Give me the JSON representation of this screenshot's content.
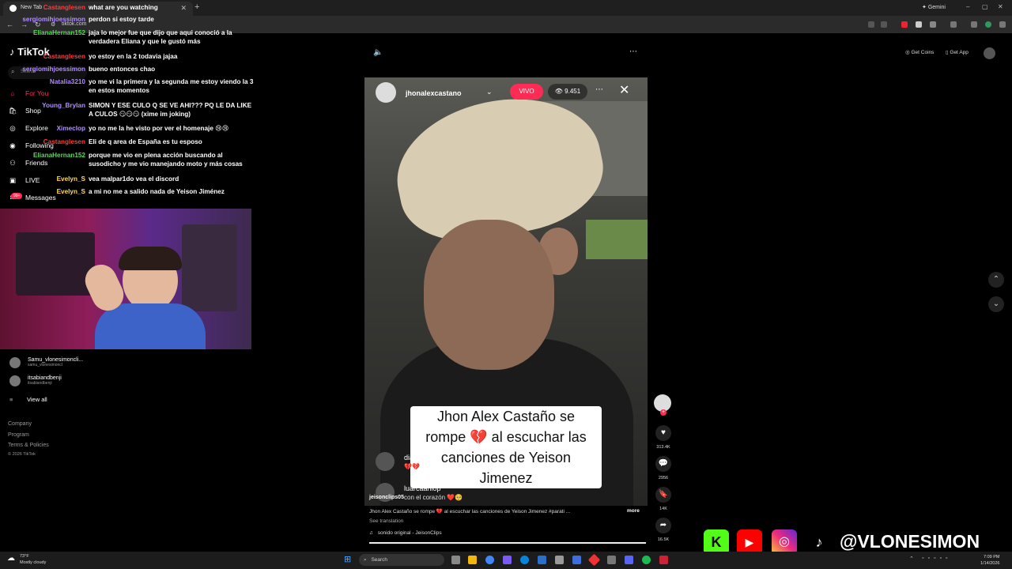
{
  "browser": {
    "tab_title": "New Tab",
    "url": "tiktok.com",
    "gemini_label": "Gemini"
  },
  "chat": {
    "messages": [
      {
        "user": "Castanglesen",
        "text": "what are you watching",
        "color": "#ff3b3b"
      },
      {
        "user": "sergiomihjoessimon",
        "text": "perdon si estoy tarde",
        "color": "#b18cff"
      },
      {
        "user": "ElianaHernan152",
        "text": "jaja lo mejor fue que dijo que aqui conoció a la verdadera Eliana y que le gustó más",
        "color": "#5bd65b"
      },
      {
        "user": "Castanglesen",
        "text": "yo estoy en la 2 todavia jajaa",
        "color": "#ff3b3b"
      },
      {
        "user": "sergiomihjoessimon",
        "text": "bueno entonces chao",
        "color": "#b18cff"
      },
      {
        "user": "Natalia3210",
        "text": "yo me vi la primera y la segunda me estoy viendo la 3 en estos momentos",
        "color": "#b18cff"
      },
      {
        "user": "Young_Brylan",
        "text": "SIMON Y ESE CULO Q SE VE AHI??? PQ LE DA LIKE A CULOS 😏😏😏 (xime im joking)",
        "color": "#b18cff"
      },
      {
        "user": "Ximeclop",
        "text": "yo no me la he visto por ver el homenaje 😢😢",
        "color": "#b18cff"
      },
      {
        "user": "Castanglesen",
        "text": "Eli de q area de España es tu esposo",
        "color": "#ff3b3b"
      },
      {
        "user": "ElianaHernan152",
        "text": "porque me vio en plena acción buscando al susodicho y me vio manejando moto y más cosas",
        "color": "#5bd65b"
      },
      {
        "user": "Evelyn_S",
        "text": "vea malpar1do vea el discord",
        "color": "#ffd75b"
      },
      {
        "user": "Evelyn_S",
        "text": "a mi no me a salido nada de Yeison Jiménez",
        "color": "#ffd75b"
      }
    ]
  },
  "sidebar": {
    "logo": "TikTok",
    "search_placeholder": "Search",
    "items": [
      {
        "label": "For You",
        "icon": "home-icon",
        "color": "#fe2c55"
      },
      {
        "label": "Shop",
        "icon": "shop-icon",
        "color": "#ffffff"
      },
      {
        "label": "Explore",
        "icon": "compass-icon",
        "color": "#ffffff"
      },
      {
        "label": "Following",
        "icon": "following-icon",
        "color": "#ffffff"
      },
      {
        "label": "Friends",
        "icon": "friends-icon",
        "color": "#ffffff"
      },
      {
        "label": "LIVE",
        "icon": "live-icon",
        "color": "#ffffff"
      },
      {
        "label": "Messages",
        "icon": "messages-icon",
        "color": "#ffffff"
      }
    ],
    "messages_badge": "99+",
    "following_accounts": [
      {
        "name": "Samu_vlonesimoncli...",
        "handle": "samu_vlonesimoncl"
      },
      {
        "name": "itsabiandbenji",
        "handle": "itsabiandbenji"
      }
    ],
    "view_all": "View all",
    "footer": [
      "Company",
      "Program",
      "Terms & Policies",
      "© 2026 TikTok"
    ]
  },
  "header": {
    "get_coins": "Get Coins",
    "get_app": "Get App"
  },
  "video": {
    "streamer": "jhonalexcastano",
    "live_badge": "VIVO",
    "viewers": "9.451",
    "caption": "Jhon Alex Castaño se rompe 💔 al escuchar las canciones de Yeison Jimenez",
    "live_comments": [
      {
        "user": "dian",
        "text": "💔💔"
      },
      {
        "user": "luarcaanlop",
        "text": "con el corazón ❤️🥺"
      }
    ],
    "watermark": "jeisonclips05",
    "description": "Jhon Alex Castaño se rompe 💔 al escuchar las canciones de Yeison Jimenez #parati ...",
    "more": "more",
    "see_translation": "See translation",
    "sound": "sonido original - JeisonClips"
  },
  "rail": {
    "likes": "313.4K",
    "comments": "2956",
    "saves": "14K",
    "shares": "16.5K"
  },
  "overlay": {
    "handle": "@VLONESIMON"
  },
  "taskbar": {
    "temp": "73°F",
    "weather": "Mostly cloudy",
    "search": "Search",
    "time": "7:09 PM",
    "date": "1/14/2026"
  }
}
